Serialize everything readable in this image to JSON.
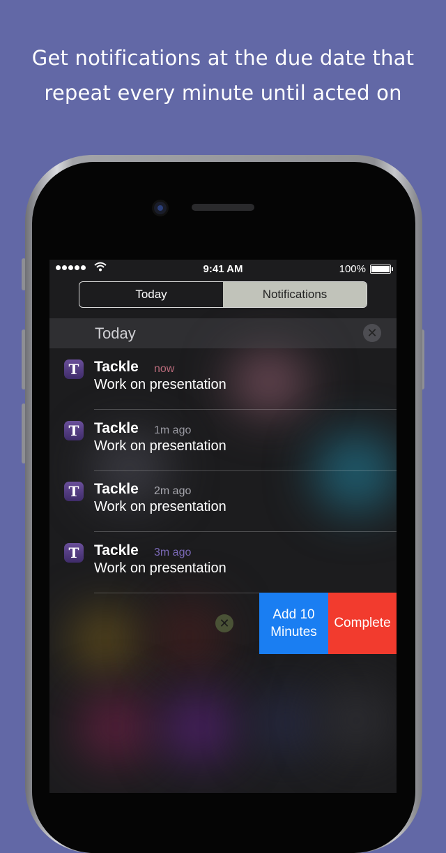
{
  "headline": {
    "line1": "Get notifications at the due date that",
    "line2": "repeat every minute until acted on"
  },
  "status_bar": {
    "time": "9:41 AM",
    "battery": "100%"
  },
  "segmented_control": {
    "tabs": [
      "Today",
      "Notifications"
    ],
    "selected": "Notifications"
  },
  "section": {
    "title": "Today",
    "clear_glyph": "✕"
  },
  "notifications": [
    {
      "app": "Tackle",
      "icon_letter": "T",
      "time": "now",
      "message": "Work on presentation",
      "time_color": "#b86a7a"
    },
    {
      "app": "Tackle",
      "icon_letter": "T",
      "time": "1m ago",
      "message": "Work on presentation",
      "time_color": "#9a9aa2"
    },
    {
      "app": "Tackle",
      "icon_letter": "T",
      "time": "2m ago",
      "message": "Work on presentation",
      "time_color": "#a7a7ae"
    },
    {
      "app": "Tackle",
      "icon_letter": "T",
      "time": "3m ago",
      "message": "Work on presentation",
      "time_color": "#7a68b5"
    }
  ],
  "actions": {
    "add_line1": "Add 10",
    "add_line2": "Minutes",
    "complete": "Complete",
    "dismiss_glyph": "✕"
  },
  "colors": {
    "background": "#6268a6",
    "add_action": "#1a7ef2",
    "complete_action": "#f23b2e"
  },
  "icons": [
    "signal-dots-icon",
    "wifi-icon",
    "battery-icon",
    "clear-icon",
    "tackle-app-icon",
    "dismiss-icon"
  ]
}
